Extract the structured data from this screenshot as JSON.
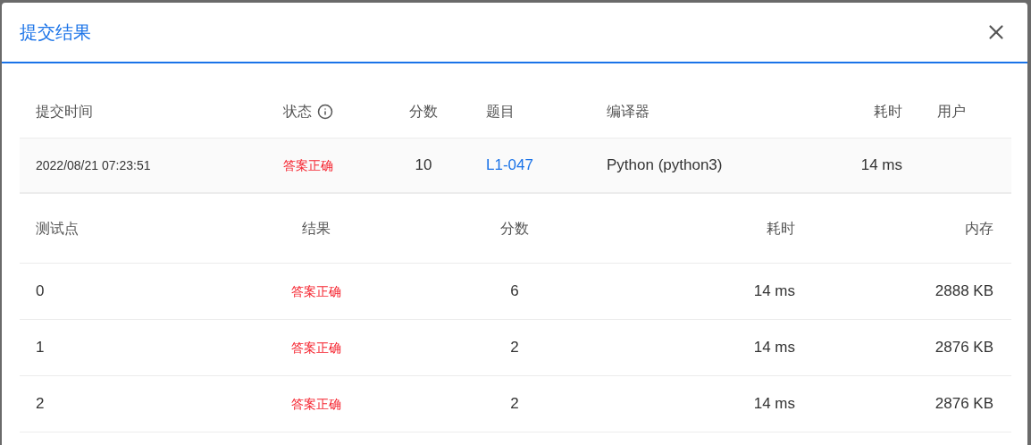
{
  "dialog": {
    "title": "提交结果"
  },
  "summary": {
    "columns": [
      {
        "label": "提交时间",
        "kind": "plain"
      },
      {
        "label": "状态",
        "kind": "with_info"
      },
      {
        "label": "分数",
        "kind": "plain"
      },
      {
        "label": "题目",
        "kind": "plain"
      },
      {
        "label": "编译器",
        "kind": "plain"
      },
      {
        "label": "耗时",
        "kind": "plain"
      },
      {
        "label": "用户",
        "kind": "plain"
      }
    ],
    "row": {
      "submitted_at": "2022/08/21 07:23:51",
      "status": {
        "text": "答案正确",
        "kind": "accepted"
      },
      "score": "10",
      "problem": "L1-047",
      "compiler": "Python (python3)",
      "time": "14 ms"
    }
  },
  "tests": {
    "columns": [
      "测试点",
      "结果",
      "分数",
      "耗时",
      "内存"
    ],
    "rows": [
      {
        "case": "0",
        "result": {
          "text": "答案正确",
          "kind": "accepted"
        },
        "score": "6",
        "time": "14 ms",
        "memory": "2888 KB"
      },
      {
        "case": "1",
        "result": {
          "text": "答案正确",
          "kind": "accepted"
        },
        "score": "2",
        "time": "14 ms",
        "memory": "2876 KB"
      },
      {
        "case": "2",
        "result": {
          "text": "答案正确",
          "kind": "accepted"
        },
        "score": "2",
        "time": "14 ms",
        "memory": "2876 KB"
      }
    ]
  }
}
